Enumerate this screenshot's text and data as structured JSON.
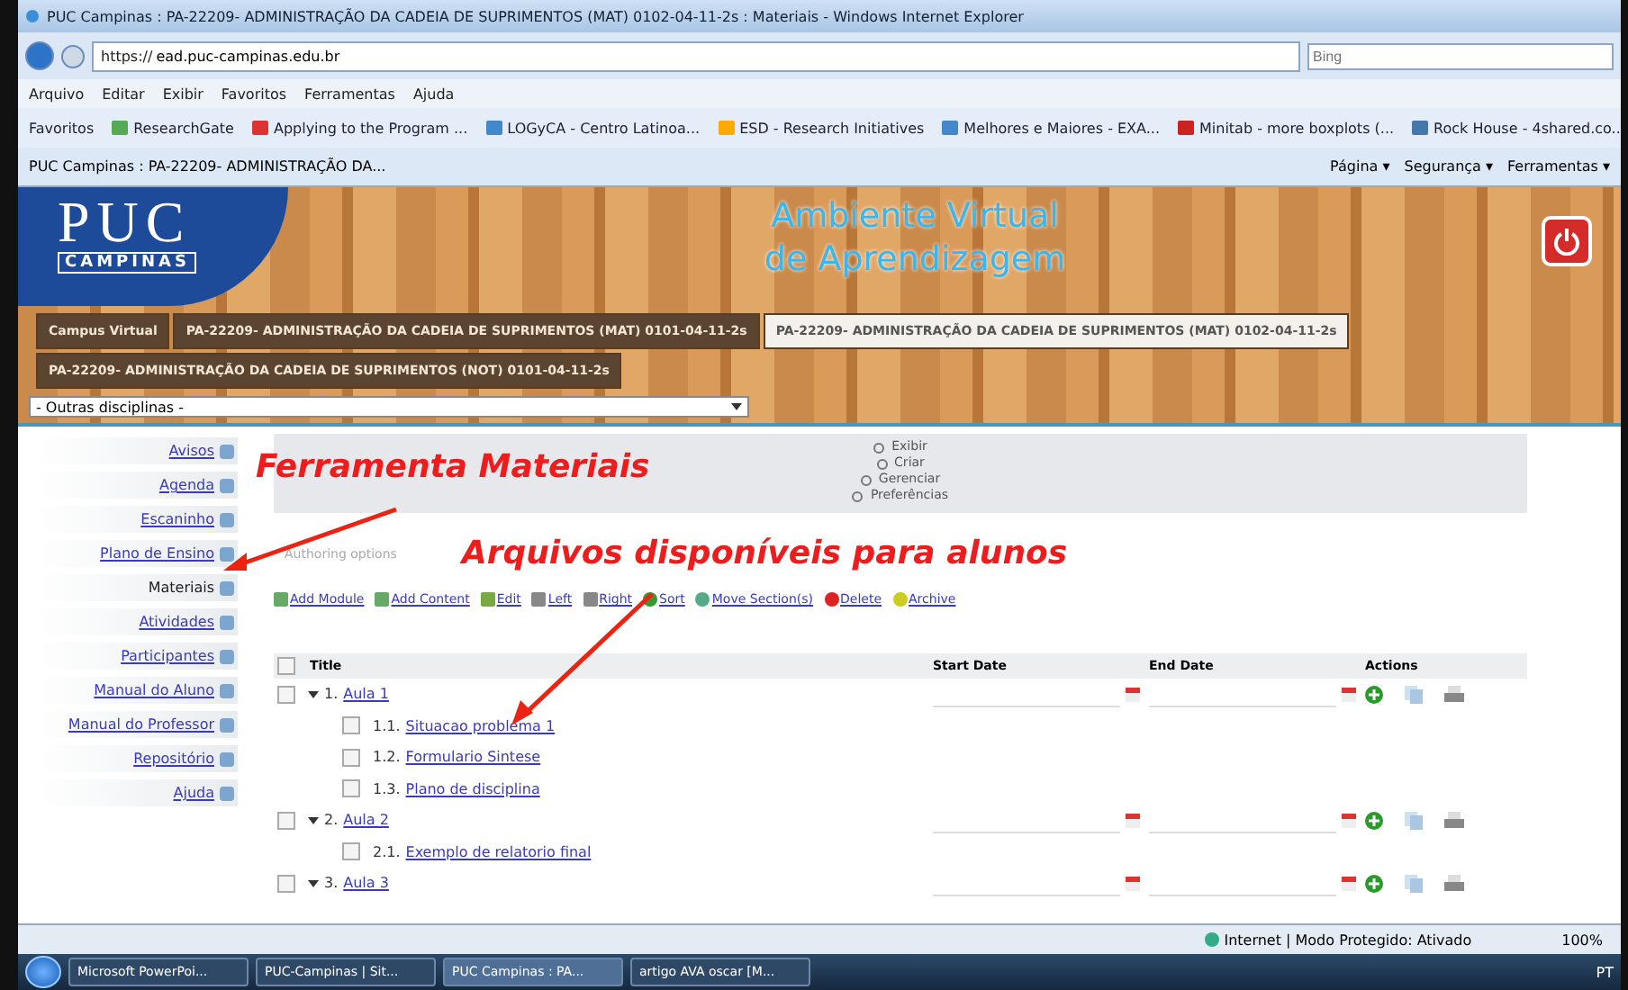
{
  "browser": {
    "title": "PUC Campinas : PA-22209- ADMINISTRAÇÃO DA CADEIA DE SUPRIMENTOS (MAT) 0102-04-11-2s : Materiais - Windows Internet Explorer",
    "url_scheme": "https://",
    "url_host": "ead.puc-campinas.edu.br",
    "search_placeholder": "Bing",
    "menu": [
      "Arquivo",
      "Editar",
      "Exibir",
      "Favoritos",
      "Ferramentas",
      "Ajuda"
    ],
    "favorites_label": "Favoritos",
    "favorites": [
      "ResearchGate",
      "Applying to the Program ...",
      "LOGyCA - Centro Latinoa...",
      "ESD - Research Initiatives",
      "Melhores e Maiores - EXA...",
      "Minitab - more boxplots (...",
      "Rock House - 4shared.co..."
    ],
    "tab_title": "PUC Campinas : PA-22209- ADMINISTRAÇÃO DA...",
    "commands": [
      "Página ▾",
      "Segurança ▾",
      "Ferramentas ▾"
    ]
  },
  "header": {
    "logo": "PUC",
    "logo_sub": "CAMPINAS",
    "title_lines": [
      "Ambiente Virtual",
      "de Aprendizagem"
    ],
    "tabs": [
      {
        "label": "Campus Virtual",
        "selected": false
      },
      {
        "label": "PA-22209- ADMINISTRAÇÃO DA CADEIA DE SUPRIMENTOS (MAT) 0101-04-11-2s",
        "selected": false
      },
      {
        "label": "PA-22209- ADMINISTRAÇÃO DA CADEIA DE SUPRIMENTOS (MAT) 0102-04-11-2s",
        "selected": true
      },
      {
        "label": "PA-22209- ADMINISTRAÇÃO DA CADEIA DE SUPRIMENTOS (NOT) 0101-04-11-2s",
        "selected": false
      }
    ],
    "dropdown": "- Outras disciplinas -"
  },
  "sidebar": {
    "items": [
      {
        "label": "Avisos",
        "selected": false
      },
      {
        "label": "Agenda",
        "selected": false
      },
      {
        "label": "Escaninho",
        "selected": false
      },
      {
        "label": "Plano de Ensino",
        "selected": false
      },
      {
        "label": "Materiais",
        "selected": true
      },
      {
        "label": "Atividades",
        "selected": false
      },
      {
        "label": "Participantes",
        "selected": false
      },
      {
        "label": "Manual do Aluno",
        "selected": false
      },
      {
        "label": "Manual do Professor",
        "selected": false
      },
      {
        "label": "Repositório",
        "selected": false
      },
      {
        "label": "Ajuda",
        "selected": false
      }
    ]
  },
  "tool_menu": [
    "Exibir",
    "Criar",
    "Gerenciar",
    "Preferências"
  ],
  "authoring": "Authoring options",
  "actions": [
    "Add Module",
    "Add Content",
    "Edit",
    "Left",
    "Right",
    "Sort",
    "Move Section(s)",
    "Delete",
    "Archive"
  ],
  "table": {
    "columns": [
      "Title",
      "Start Date",
      "End Date",
      "Actions"
    ],
    "all_checked": false,
    "modules": [
      {
        "number": "1.",
        "title": "Aula 1",
        "checked": false,
        "children": [
          {
            "number": "1.1.",
            "title": "Situacao problema 1",
            "checked": false
          },
          {
            "number": "1.2.",
            "title": "Formulario  Sintese",
            "checked": false
          },
          {
            "number": "1.3.",
            "title": "Plano de disciplina",
            "checked": false
          }
        ]
      },
      {
        "number": "2.",
        "title": "Aula 2",
        "checked": false,
        "children": [
          {
            "number": "2.1.",
            "title": "Exemplo de relatorio final",
            "checked": false
          }
        ]
      },
      {
        "number": "3.",
        "title": "Aula 3",
        "checked": false
      }
    ]
  },
  "annotations": [
    "Ferramenta Materiais",
    "Arquivos disponíveis para alunos"
  ],
  "status": {
    "text": "Internet | Modo Protegido: Ativado",
    "zoom": "100%"
  },
  "taskbar": {
    "items": [
      {
        "label": "Microsoft PowerPoi...",
        "selected": false
      },
      {
        "label": "PUC-Campinas | Sit...",
        "selected": false
      },
      {
        "label": "PUC Campinas : PA...",
        "selected": true
      },
      {
        "label": "artigo AVA oscar [M...",
        "selected": false
      }
    ],
    "lang": "PT"
  }
}
